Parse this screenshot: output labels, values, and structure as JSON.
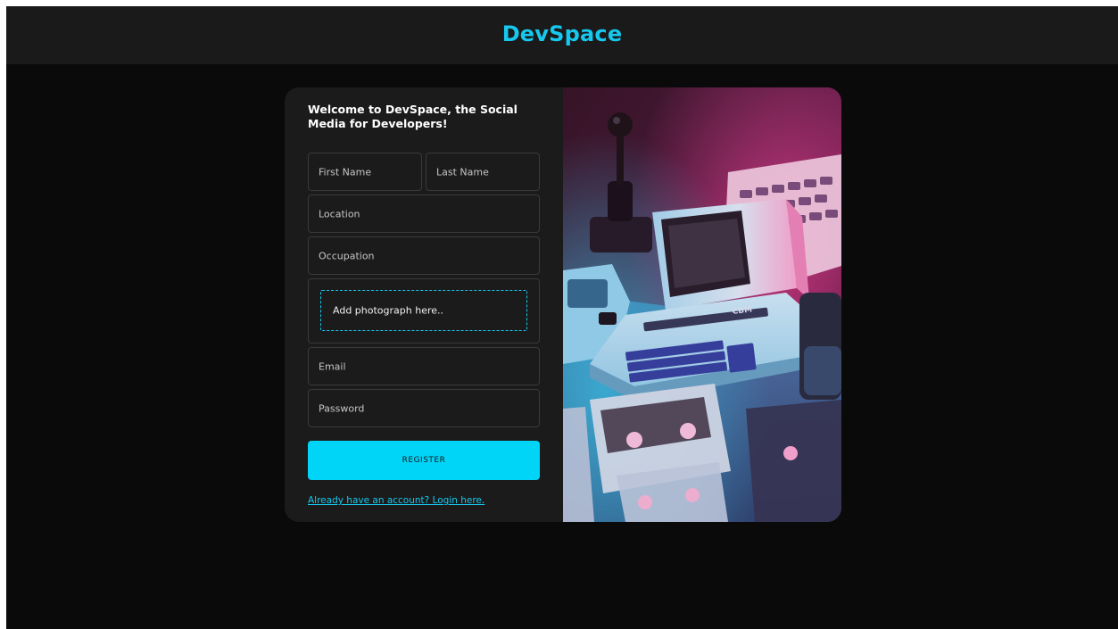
{
  "header": {
    "title": "DevSpace"
  },
  "register_form": {
    "welcome": "Welcome to DevSpace, the Social Media for Developers!",
    "first_name_placeholder": "First Name",
    "last_name_placeholder": "Last Name",
    "location_placeholder": "Location",
    "occupation_placeholder": "Occupation",
    "photo_dropzone_label": "Add photograph here..",
    "email_placeholder": "Email",
    "password_placeholder": "Password",
    "register_label": "REGISTER",
    "login_link": "Already have an account? Login here."
  },
  "hero_image": {
    "cassette_label": "CBM"
  },
  "colors": {
    "accent": "#16c8ee",
    "button": "#00d4f7",
    "page_background": "#0a0a0a",
    "header_background": "#1a1a1a",
    "card_background": "#1b1b1b"
  }
}
